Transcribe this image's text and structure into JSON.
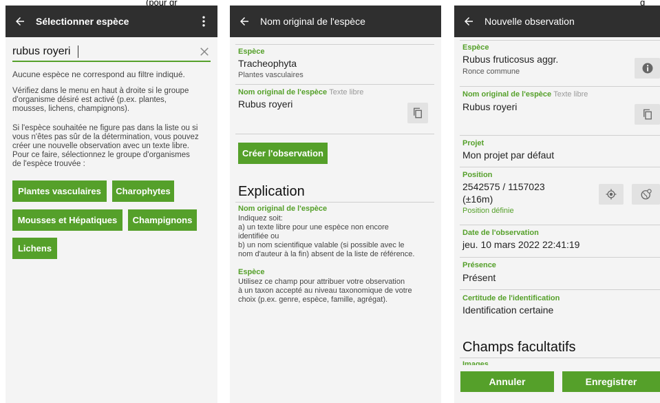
{
  "top_caption": {
    "left": "(pour gr",
    "right": "g"
  },
  "screen1": {
    "title": "Sélectionner espèce",
    "search_value": "rubus royeri",
    "no_match": "Aucune espèce ne correspond au filtre indiqué.",
    "para1": [
      "Vérifiez dans le menu en haut à droite si le groupe",
      "d'organisme désiré est activé (p.ex. plantes,",
      "mousses, lichens, champignons)."
    ],
    "para2": [
      "Si l'espèce souhaitée ne figure pas dans la liste ou si",
      "vous n'êtes pas sûr de la détermination, vous pouvez",
      "créer une nouvelle observation avec un texte libre.",
      "Pour ce faire, sélectionnez le groupe d'organismes",
      "de l'espèce trouvée :"
    ],
    "buttons": [
      "Plantes vasculaires",
      "Charophytes",
      "Mousses et Hépatiques",
      "Champignons",
      "Lichens"
    ]
  },
  "screen2": {
    "title": "Nom original de l'espèce",
    "species_label": "Espèce",
    "species_value": "Tracheophyta",
    "species_sub": "Plantes vasculaires",
    "orig_label": "Nom original de l'espèce",
    "free_text": "Texte libre",
    "orig_value": "Rubus royeri",
    "create_button": "Créer l'observation",
    "explication_heading": "Explication",
    "exp_orig_label": "Nom original de l'espèce",
    "exp_orig_lines": [
      "Indiquez soit:",
      "a) un texte libre pour une espèce non encore",
      "identifiée ou",
      "b) un nom scientifique valable (si possible avec le",
      "nom d'auteur à la fin) absent de la liste de référence."
    ],
    "exp_species_label": "Espèce",
    "exp_species_lines": [
      "Utilisez ce champ pour attribuer votre observation",
      "à un taxon accepté au niveau taxonomique de votre",
      "choix (p.ex. genre, espèce, famille, agrégat)."
    ]
  },
  "screen3": {
    "title": "Nouvelle observation",
    "species_label": "Espèce",
    "species_value": "Rubus fruticosus aggr.",
    "species_sub": "Ronce commune",
    "orig_label": "Nom original de l'espèce",
    "free_text": "Texte libre",
    "orig_value": "Rubus royeri",
    "project_label": "Projet",
    "project_value": "Mon projet par défaut",
    "position_label": "Position",
    "position_value": "2542575 / 1157023",
    "position_precision": "(±16m)",
    "position_status": "Position définie",
    "date_label": "Date de l'observation",
    "date_value": "jeu. 10 mars 2022 22:41:19",
    "presence_label": "Présence",
    "presence_value": "Présent",
    "certainty_label": "Certitude de l'identification",
    "certainty_value": "Identification certaine",
    "optional_heading": "Champs facultatifs",
    "images_label": "Images",
    "cancel_button": "Annuler",
    "save_button": "Enregistrer"
  }
}
